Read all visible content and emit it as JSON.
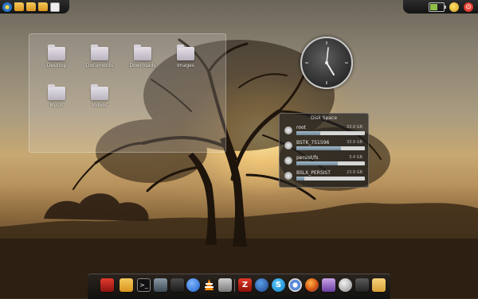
{
  "desktop": {
    "folders": [
      {
        "label": "Desktop"
      },
      {
        "label": "Documents"
      },
      {
        "label": "Downloads"
      },
      {
        "label": "Images"
      },
      {
        "label": "Music"
      },
      {
        "label": "Videos"
      }
    ]
  },
  "disk_space": {
    "title": "Disk Space",
    "drives": [
      {
        "name": "root",
        "value": "33.9 GB",
        "used_fraction": 0.35
      },
      {
        "name": "BSTK_751596",
        "value": "33.9 GB",
        "used_fraction": 0.65
      },
      {
        "name": "persist/fs",
        "value": "3.4 GB",
        "used_fraction": 0.6
      },
      {
        "name": "BSLX_PERSIST",
        "value": "23.9 GB",
        "used_fraction": 0.12
      }
    ]
  },
  "top_panel": {
    "left_icons": [
      "kde-menu-icon",
      "folder-icon",
      "folder-icon",
      "folder-icon",
      "text-editor-icon"
    ],
    "right_icons": [
      "battery-icon",
      "network-icon",
      "power-icon"
    ],
    "battery_level": 0.55
  },
  "dock": {
    "items": [
      "media-player-icon",
      "file-manager-icon",
      "terminal-icon",
      "system-monitor-icon",
      "network-tool-icon",
      "music-player-icon",
      "vlc-icon",
      "document-viewer-icon",
      "filezilla-icon",
      "flash-icon",
      "skype-icon",
      "chromium-icon",
      "firefox-icon",
      "pidgin-icon",
      "disk-utility-icon",
      "mixer-icon",
      "trash-icon"
    ]
  },
  "colors": {
    "panel_dark": "#1a1a1a",
    "folder_tint": "#d7d2da",
    "disk_bar_fill": "#7f98aa"
  }
}
